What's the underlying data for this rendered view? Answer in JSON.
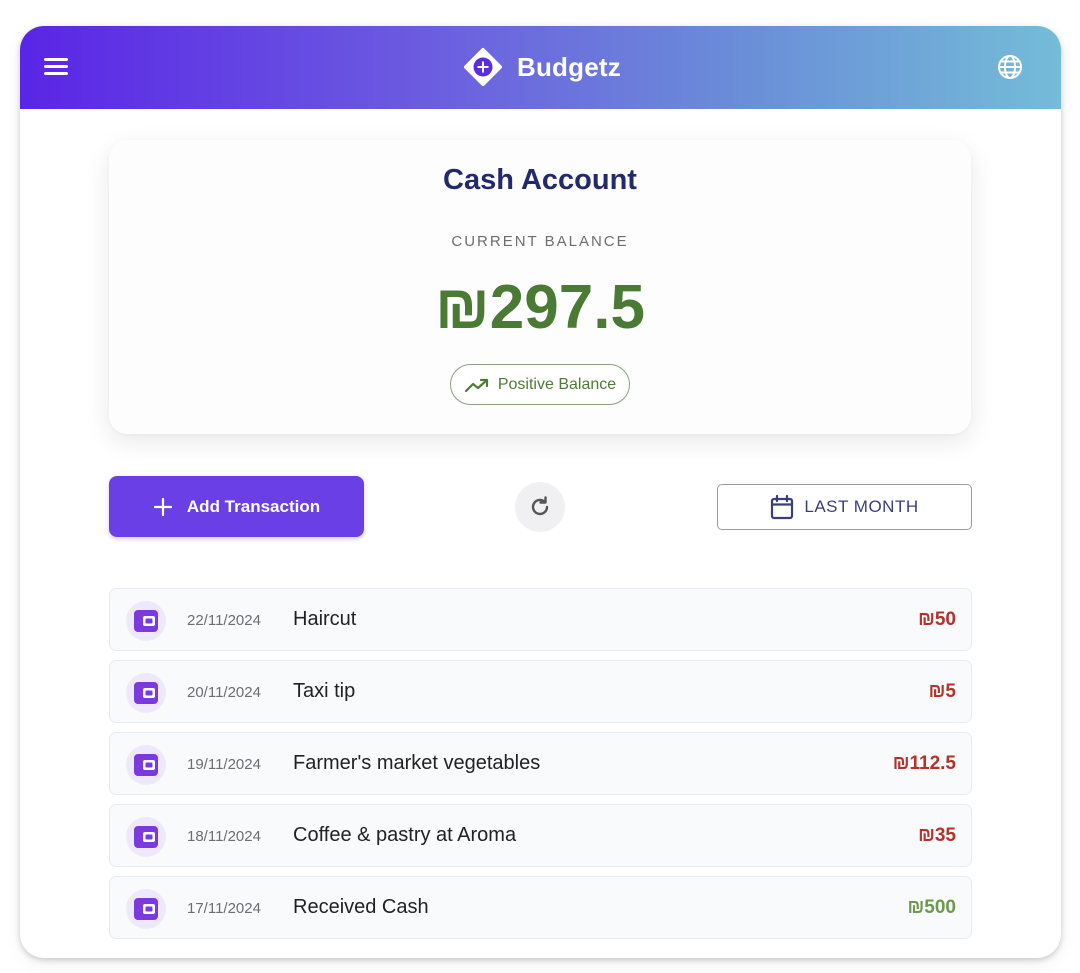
{
  "header": {
    "brand": "Budgetz",
    "menu_icon": "hamburger-menu-icon",
    "logo_icon": "diamond-plus-logo-icon",
    "language_icon": "globe-icon",
    "gradient": [
      "#5a25e6",
      "#74bcd8"
    ]
  },
  "account": {
    "title": "Cash Account",
    "balance_caption": "CURRENT BALANCE",
    "balance": "₪297.5",
    "status_badge": "Positive Balance",
    "status_icon": "trending-up-icon"
  },
  "actions": {
    "add_label": "Add Transaction",
    "add_icon": "plus-icon",
    "refresh_icon": "refresh-icon",
    "range_label": "LAST MONTH",
    "range_icon": "calendar-icon"
  },
  "transactions": [
    {
      "date": "22/11/2024",
      "description": "Haircut",
      "amount": "₪50",
      "type": "expense",
      "icon": "wallet-icon"
    },
    {
      "date": "20/11/2024",
      "description": "Taxi tip",
      "amount": "₪5",
      "type": "expense",
      "icon": "wallet-icon"
    },
    {
      "date": "19/11/2024",
      "description": "Farmer's market vegetables",
      "amount": "₪112.5",
      "type": "expense",
      "icon": "wallet-icon"
    },
    {
      "date": "18/11/2024",
      "description": "Coffee & pastry at Aroma",
      "amount": "₪35",
      "type": "expense",
      "icon": "wallet-icon"
    },
    {
      "date": "17/11/2024",
      "description": "Received Cash",
      "amount": "₪500",
      "type": "income",
      "icon": "wallet-icon"
    }
  ],
  "colors": {
    "primary": "#6a40e6",
    "expense": "#b3322c",
    "income": "#6c9a4d",
    "balance": "#4a7a34",
    "title": "#232a6b"
  }
}
